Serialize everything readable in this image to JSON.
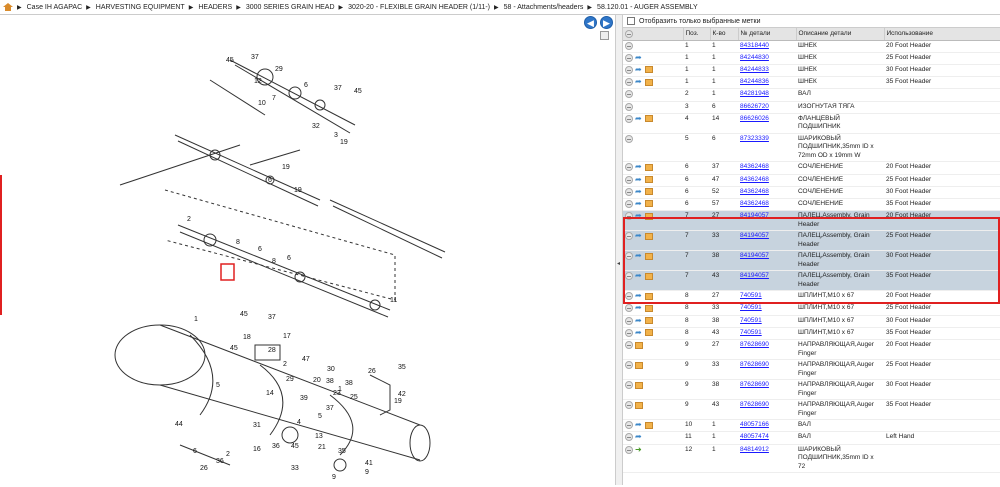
{
  "breadcrumb": [
    "Case IH AGAPAC",
    "HARVESTING EQUIPMENT",
    "HEADERS",
    "3000 SERIES GRAIN HEAD",
    "3020-20 - FLEXIBLE GRAIN HEADER (1/11-)",
    "58 - Attachments/headers",
    "58.120.01 - AUGER ASSEMBLY"
  ],
  "filter_label": "Отобразить только выбранные метки",
  "headers": {
    "pos": "Поз.",
    "qty": "К-во",
    "part": "№ детали",
    "desc": "Описание детали",
    "use": "Использование"
  },
  "callouts": [
    "45",
    "37",
    "29",
    "12",
    "10",
    "7",
    "6",
    "37",
    "45",
    "32",
    "3",
    "19",
    "19",
    "6",
    "19",
    "2",
    "8",
    "6",
    "8",
    "6",
    "11",
    "5",
    "1",
    "45",
    "37",
    "18",
    "45",
    "17",
    "28",
    "2",
    "29",
    "47",
    "30",
    "20",
    "39",
    "38",
    "23",
    "37",
    "38",
    "25",
    "26",
    "35",
    "42",
    "31",
    "16",
    "36",
    "45",
    "13",
    "44",
    "6",
    "26",
    "2",
    "36",
    "14",
    "1",
    "19",
    "35",
    "41",
    "9",
    "9",
    "21",
    "33",
    "4",
    "5"
  ],
  "rows": [
    {
      "icons": "c",
      "pos": "1",
      "qty": "1",
      "part": "84318440",
      "desc": "ШНЕК",
      "use": "20 Foot Header",
      "sel": false
    },
    {
      "icons": "ca",
      "pos": "1",
      "qty": "1",
      "part": "84244830",
      "desc": "ШНЕК",
      "use": "25 Foot Header",
      "sel": false
    },
    {
      "icons": "cab",
      "pos": "1",
      "qty": "1",
      "part": "84244833",
      "desc": "ШНЕК",
      "use": "30 Foot Header",
      "sel": false
    },
    {
      "icons": "cab",
      "pos": "1",
      "qty": "1",
      "part": "84244836",
      "desc": "ШНЕК",
      "use": "35 Foot Header",
      "sel": false
    },
    {
      "icons": "c",
      "pos": "2",
      "qty": "1",
      "part": "84281948",
      "desc": "ВАЛ",
      "use": "",
      "sel": false
    },
    {
      "icons": "c",
      "pos": "3",
      "qty": "6",
      "part": "86626720",
      "desc": "ИЗОГНУТАЯ ТЯГА",
      "use": "",
      "sel": false
    },
    {
      "icons": "cab",
      "pos": "4",
      "qty": "14",
      "part": "86626026",
      "desc": "ФЛАНЦЕВЫЙ ПОДШИПНИК",
      "use": "",
      "sel": false
    },
    {
      "icons": "c",
      "pos": "5",
      "qty": "6",
      "part": "87323339",
      "desc": "ШАРИКОВЫЙ ПОДШИПНИК,35mm ID x 72mm OD x 19mm W",
      "use": "",
      "sel": false
    },
    {
      "icons": "cab",
      "pos": "6",
      "qty": "37",
      "part": "84362468",
      "desc": "СОЧЛЕНЕНИЕ",
      "use": "20 Foot Header",
      "sel": false
    },
    {
      "icons": "cab",
      "pos": "6",
      "qty": "47",
      "part": "84362468",
      "desc": "СОЧЛЕНЕНИЕ",
      "use": "25 Foot Header",
      "sel": false
    },
    {
      "icons": "cab",
      "pos": "6",
      "qty": "52",
      "part": "84362468",
      "desc": "СОЧЛЕНЕНИЕ",
      "use": "30 Foot Header",
      "sel": false
    },
    {
      "icons": "cab",
      "pos": "6",
      "qty": "57",
      "part": "84362468",
      "desc": "СОЧЛЕНЕНИЕ",
      "use": "35 Foot Header",
      "sel": false
    },
    {
      "icons": "cab",
      "pos": "7",
      "qty": "27",
      "part": "84194057",
      "desc": "ПАЛЕЦ,Assembly, Grain Header",
      "use": "20 Foot Header",
      "sel": true
    },
    {
      "icons": "cab",
      "pos": "7",
      "qty": "33",
      "part": "84194057",
      "desc": "ПАЛЕЦ,Assembly, Grain Header",
      "use": "25 Foot Header",
      "sel": true
    },
    {
      "icons": "cab",
      "pos": "7",
      "qty": "38",
      "part": "84194057",
      "desc": "ПАЛЕЦ,Assembly, Grain Header",
      "use": "30 Foot Header",
      "sel": true
    },
    {
      "icons": "cab",
      "pos": "7",
      "qty": "43",
      "part": "84194057",
      "desc": "ПАЛЕЦ,Assembly, Grain Header",
      "use": "35 Foot Header",
      "sel": true
    },
    {
      "icons": "cab",
      "pos": "8",
      "qty": "27",
      "part": "740591",
      "desc": "ШПЛИНТ,M10 x 67",
      "use": "20 Foot Header",
      "sel": false
    },
    {
      "icons": "cab",
      "pos": "8",
      "qty": "33",
      "part": "740591",
      "desc": "ШПЛИНТ,M10 x 67",
      "use": "25 Foot Header",
      "sel": false
    },
    {
      "icons": "cab",
      "pos": "8",
      "qty": "38",
      "part": "740591",
      "desc": "ШПЛИНТ,M10 x 67",
      "use": "30 Foot Header",
      "sel": false
    },
    {
      "icons": "cab",
      "pos": "8",
      "qty": "43",
      "part": "740591",
      "desc": "ШПЛИНТ,M10 x 67",
      "use": "35 Foot Header",
      "sel": false
    },
    {
      "icons": "cb",
      "pos": "9",
      "qty": "27",
      "part": "87628690",
      "desc": "НАПРАВЛЯЮЩАЯ,Auger Finger",
      "use": "20 Foot Header",
      "sel": false
    },
    {
      "icons": "cb",
      "pos": "9",
      "qty": "33",
      "part": "87628690",
      "desc": "НАПРАВЛЯЮЩАЯ,Auger Finger",
      "use": "25 Foot Header",
      "sel": false
    },
    {
      "icons": "cb",
      "pos": "9",
      "qty": "38",
      "part": "87628690",
      "desc": "НАПРАВЛЯЮЩАЯ,Auger Finger",
      "use": "30 Foot Header",
      "sel": false
    },
    {
      "icons": "cb",
      "pos": "9",
      "qty": "43",
      "part": "87628690",
      "desc": "НАПРАВЛЯЮЩАЯ,Auger Finger",
      "use": "35 Foot Header",
      "sel": false
    },
    {
      "icons": "cab",
      "pos": "10",
      "qty": "1",
      "part": "48057166",
      "desc": "ВАЛ",
      "use": "",
      "sel": false
    },
    {
      "icons": "ca",
      "pos": "11",
      "qty": "1",
      "part": "48057474",
      "desc": "ВАЛ",
      "use": "Left Hand",
      "sel": false
    },
    {
      "icons": "cg",
      "pos": "12",
      "qty": "1",
      "part": "84814912",
      "desc": "ШАРИКОВЫЙ ПОДШИПНИК,35mm ID x 72",
      "use": "",
      "sel": false
    }
  ]
}
